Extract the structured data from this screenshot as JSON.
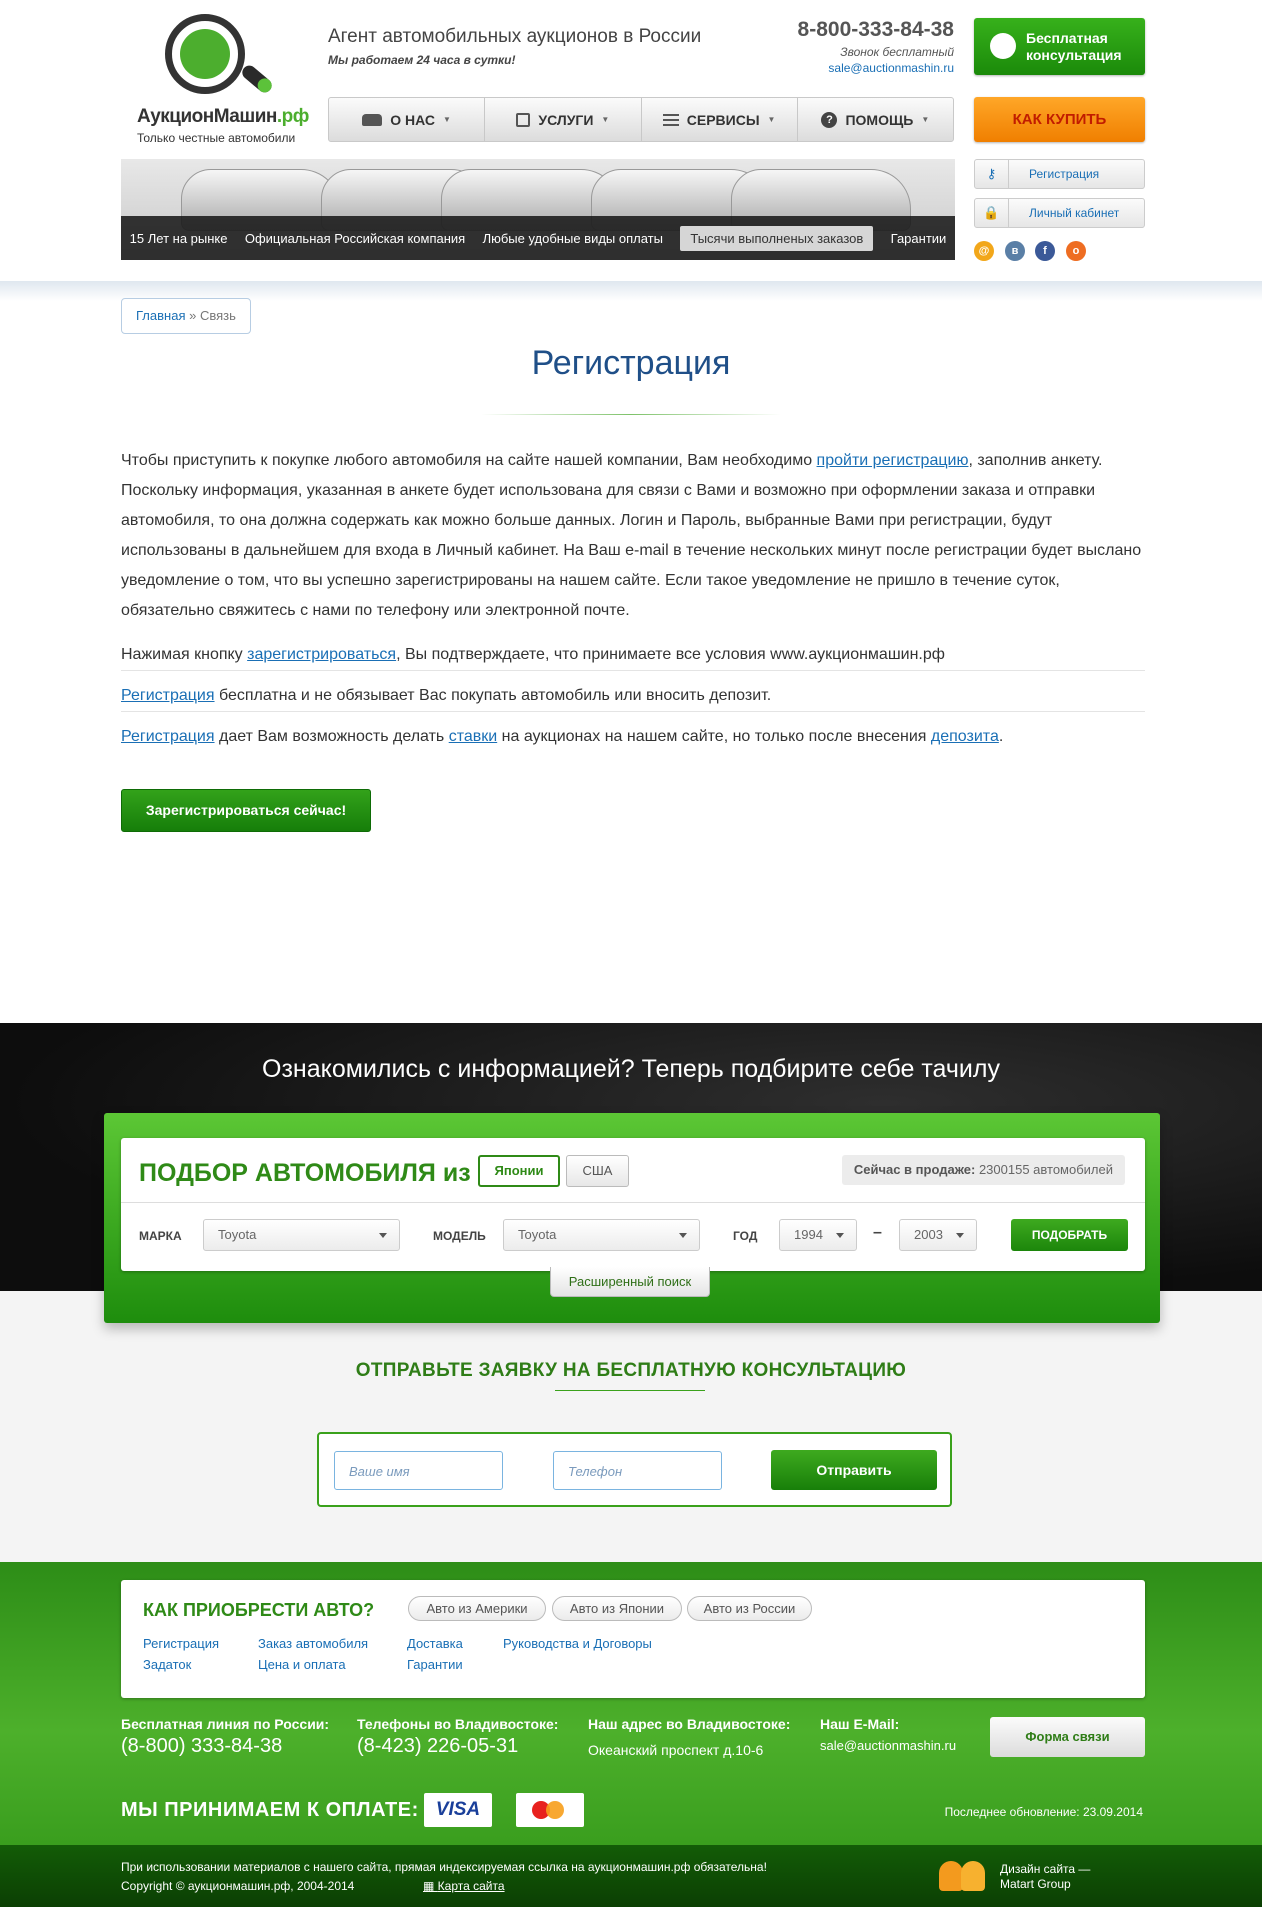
{
  "header": {
    "brand_name": "АукционМашин",
    "brand_suffix": ".рф",
    "brand_sub": "Только честные автомобили",
    "tagline": "Агент автомобильных аукционов в России",
    "tagline_sub": "Мы работаем 24 часа в сутки!",
    "phone": "8-800-333-84-38",
    "phone_note": "Звонок бесплатный",
    "email": "sale@auctionmashin.ru",
    "consult_btn": "Бесплатная консультация",
    "buy_btn": "КАК КУПИТЬ",
    "nav": [
      {
        "label": "О НАС",
        "icon": "car-icon"
      },
      {
        "label": "УСЛУГИ",
        "icon": "bag-icon"
      },
      {
        "label": "СЕРВИСЫ",
        "icon": "list-icon"
      },
      {
        "label": "ПОМОЩЬ",
        "icon": "question-icon"
      }
    ],
    "banner_items": [
      "15 Лет на рынке",
      "Официальная Российская компания",
      "Любые удобные виды оплаты",
      "Тысячи выполненых заказов",
      "Гарантии"
    ],
    "side_buttons": {
      "register": "Регистрация",
      "cabinet": "Личный кабинет"
    },
    "social": [
      "mail-icon",
      "vk-icon",
      "facebook-icon",
      "odnoklassniki-icon"
    ]
  },
  "breadcrumb": {
    "home": "Главная",
    "sep": "»",
    "current": "Связь"
  },
  "page": {
    "title": "Регистрация",
    "p1_a": "Чтобы приступить к покупке любого автомобиля на сайте нашей компании, Вам необходимо ",
    "p1_link": "пройти регистрацию",
    "p1_b": ", заполнив анкету. Поскольку информация, указанная в анкете будет использована для связи с Вами и возможно при оформлении заказа и отправки автомобиля, то она должна содержать как можно больше данных. Логин и Пароль, выбранные Вами при регистрации, будут использованы в дальнейшем для входа в Личный кабинет. На Ваш e-mail в течение нескольких минут после регистрации будет выслано уведомление о том, что вы успешно зарегистрированы на нашем сайте. Если такое уведомление не пришло в течение суток, обязательно свяжитесь с нами по телефону или электронной почте.",
    "p2_a": "Нажимая кнопку ",
    "p2_link": "зарегистрироваться",
    "p2_b": ", Вы подтверждаете, что принимаете все условия www.аукционмашин.рф",
    "p3_link": "Регистрация",
    "p3_b": " бесплатна и не обязывает Вас покупать автомобиль или вносить депозит.",
    "p4_link1": "Регистрация",
    "p4_b": " дает Вам возможность делать ",
    "p4_link2": "ставки",
    "p4_c": " на аукционах на нашем сайте, но только после внесения ",
    "p4_link3": "депозита",
    "p4_d": ".",
    "register_btn": "Зарегистрироваться сейчас!"
  },
  "picker": {
    "section_title": "Ознакомились с информацией? Теперь подбирите себе тачилу",
    "heading": "ПОДБОР АВТОМОБИЛЯ из",
    "tab_japan": "Японии",
    "tab_usa": "США",
    "sale_label": "Сейчас в продаже:",
    "sale_value": "2300155 автомобилей",
    "make_label": "МАРКА",
    "make_value": "Toyota",
    "model_label": "МОДЕЛЬ",
    "model_value": "Toyota",
    "year_label": "ГОД",
    "year_from": "1994",
    "year_dash": "–",
    "year_to": "2003",
    "find_btn": "ПОДОБРАТЬ",
    "extended": "Расширенный поиск"
  },
  "consult": {
    "title": "ОТПРАВЬТЕ ЗАЯВКУ НА БЕСПЛАТНУЮ КОНСУЛЬТАЦИЮ",
    "name_ph": "Ваше имя",
    "phone_ph": "Телефон",
    "send_btn": "Отправить"
  },
  "footer": {
    "how_title": "КАК ПРИОБРЕСТИ АВТО?",
    "tabs": [
      "Авто из Америки",
      "Авто из Японии",
      "Авто из России"
    ],
    "links": [
      "Регистрация",
      "Задаток",
      "Заказ автомобиля",
      "Цена и оплата",
      "Доставка",
      "Гарантии",
      "Руководства и Договоры"
    ],
    "free_line_label": "Бесплатная линия по России:",
    "free_line": "(8-800) 333-84-38",
    "vl_phones_label": "Телефоны во Владивостоке:",
    "vl_phones": "(8-423) 226-05-31",
    "address_label": "Наш адрес во Владивостоке:",
    "address": "Океанский проспект д.10-6",
    "email_label": "Наш E-Mail:",
    "email": "sale@auctionmashin.ru",
    "form_btn": "Форма связи",
    "pay_title": "МЫ ПРИНИМАЕМ К ОПЛАТЕ:",
    "visa": "VISA",
    "updated": "Последнее обновление: 23.09.2014",
    "notice": "При использовании материалов с нашего сайта, прямая индексируемая ссылка на аукционмашин.рф обязательна!",
    "copyright": "Copyright © аукционмашин.рф, 2004-2014",
    "sitemap": "Карта сайта",
    "design": "Дизайн сайта —",
    "design_by": "Matart Group"
  }
}
